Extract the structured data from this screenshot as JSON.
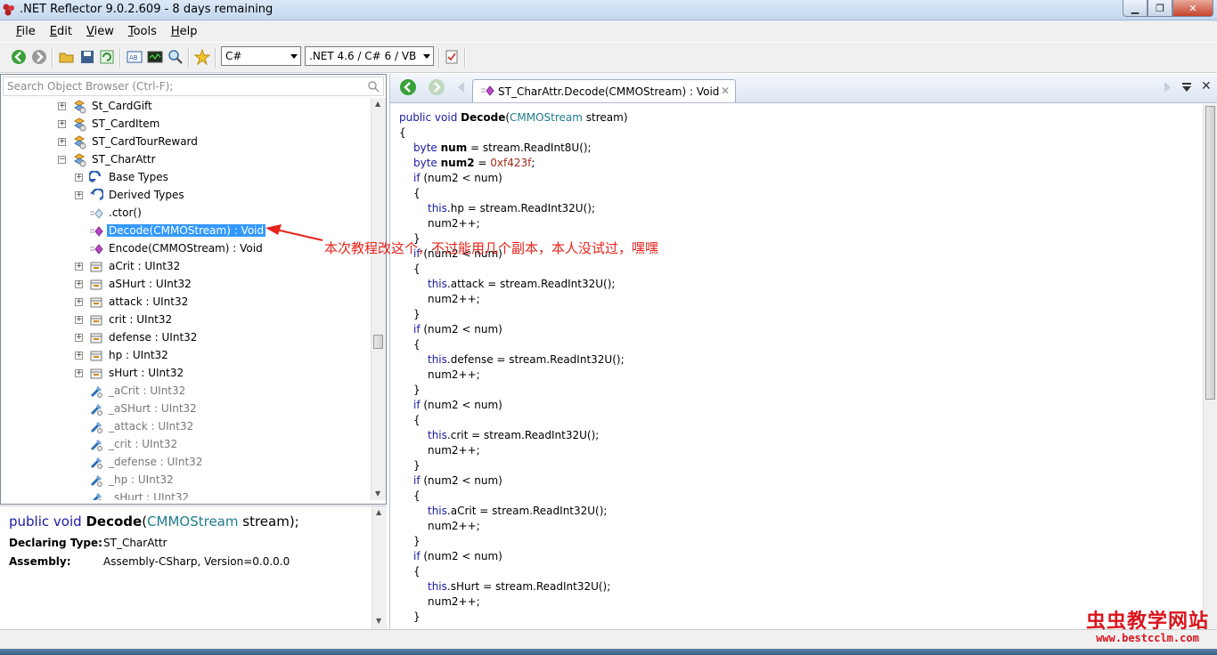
{
  "window": {
    "title": ".NET Reflector 9.0.2.609 - 8 days remaining"
  },
  "menu": [
    "File",
    "Edit",
    "View",
    "Tools",
    "Help"
  ],
  "toolbar": {
    "language": "C#",
    "framework": ".NET 4.6 / C# 6 / VB"
  },
  "search": {
    "placeholder": "Search Object Browser (Ctrl-F);"
  },
  "tree": [
    {
      "label": "St_CardGift",
      "icon": "class-icon"
    },
    {
      "label": "ST_CardItem",
      "icon": "class-icon"
    },
    {
      "label": "ST_CardTourReward",
      "icon": "class-icon"
    },
    {
      "label": "ST_CharAttr",
      "icon": "class-icon",
      "expanded": true
    },
    {
      "label": "Base Types",
      "icon": "base-types-icon"
    },
    {
      "label": "Derived Types",
      "icon": "derived-types-icon"
    },
    {
      "label": ".ctor()",
      "icon": "constructor-icon"
    },
    {
      "label": "Decode(CMMOStream) : Void",
      "icon": "method-icon",
      "selected": true
    },
    {
      "label": "Encode(CMMOStream) : Void",
      "icon": "method-icon"
    },
    {
      "label": "aCrit : UInt32",
      "icon": "property-icon"
    },
    {
      "label": "aSHurt : UInt32",
      "icon": "property-icon"
    },
    {
      "label": "attack : UInt32",
      "icon": "property-icon"
    },
    {
      "label": "crit : UInt32",
      "icon": "property-icon"
    },
    {
      "label": "defense : UInt32",
      "icon": "property-icon"
    },
    {
      "label": "hp : UInt32",
      "icon": "property-icon"
    },
    {
      "label": "sHurt : UInt32",
      "icon": "property-icon"
    },
    {
      "label": "_aCrit : UInt32",
      "icon": "field-icon"
    },
    {
      "label": "_aSHurt : UInt32",
      "icon": "field-icon"
    },
    {
      "label": "_attack : UInt32",
      "icon": "field-icon"
    },
    {
      "label": "_crit : UInt32",
      "icon": "field-icon"
    },
    {
      "label": "_defense : UInt32",
      "icon": "field-icon"
    },
    {
      "label": "_hp : UInt32",
      "icon": "field-icon"
    },
    {
      "label": "_sHurt : UInt32",
      "icon": "field-icon"
    }
  ],
  "info": {
    "sig_public": "public",
    "sig_void": "void",
    "sig_name": "Decode",
    "sig_open": "(",
    "sig_type": "CMMOStream",
    "sig_rest": " stream);",
    "declaring_type_label": "Declaring Type:",
    "declaring_type": "ST_CharAttr",
    "assembly_label": "Assembly:",
    "assembly": "Assembly-CSharp, Version=0.0.0.0"
  },
  "tab": {
    "label": "ST_CharAttr.Decode(CMMOStream) : Void"
  },
  "code": {
    "l1_a": "public void ",
    "l1_b": "Decode",
    "l1_c": "(",
    "l1_d": "CMMOStream",
    "l1_e": " stream)",
    "open": "{",
    "close": "}",
    "byte": "byte ",
    "num": "num",
    "eq_read8": " = stream.ReadInt8U();",
    "num2": "num2",
    "eq_hex": " = ",
    "hex": "0xf423f",
    "semi": ";",
    "if": "if",
    "cond": " (num2 < num)",
    "this": "this",
    "inc": "num2++;",
    "fields": [
      "hp",
      "attack",
      "defense",
      "crit",
      "aCrit",
      "sHurt"
    ],
    "read32": " = stream.ReadInt32U();"
  },
  "annotation": "本次教程改这个，不过能用几个副本，本人没试过，嘿嘿",
  "watermark": {
    "title": "虫虫教学网站",
    "url": "www.bestcclm.com"
  },
  "colors": {
    "selection": "#3399ff",
    "keyword": "#1a1aa6",
    "annotation": "#e8231b"
  }
}
